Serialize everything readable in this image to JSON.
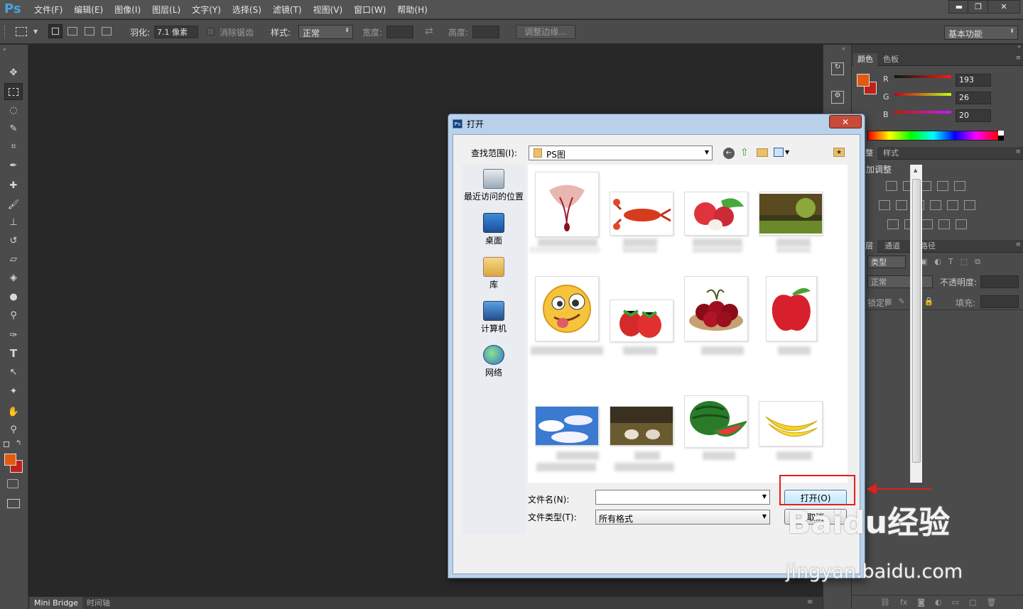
{
  "app": {
    "logo": "Ps"
  },
  "menu": [
    "文件(F)",
    "编辑(E)",
    "图像(I)",
    "图层(L)",
    "文字(Y)",
    "选择(S)",
    "滤镜(T)",
    "视图(V)",
    "窗口(W)",
    "帮助(H)"
  ],
  "window_controls": {
    "minimize": "▬",
    "restore": "❐",
    "close": "✕"
  },
  "options": {
    "feather_label": "羽化:",
    "feather_value": "7.1 像素",
    "antialias_label": "消除锯齿",
    "style_label": "样式:",
    "style_value": "正常",
    "width_label": "宽度:",
    "height_label": "高度:",
    "refine_edge": "调整边缘...",
    "workspace": "基本功能"
  },
  "bottom_tabs": [
    "Mini Bridge",
    "时间轴"
  ],
  "color_panel": {
    "tabs": [
      "颜色",
      "色板"
    ],
    "r_label": "R",
    "g_label": "G",
    "b_label": "B",
    "r": "193",
    "g": "26",
    "b": "20",
    "fg_color": "#e05a10",
    "bg_color": "#c1201a"
  },
  "adjust_panel": {
    "tabs": [
      "调整",
      "样式"
    ],
    "title": "添加调整"
  },
  "layers_panel": {
    "tabs": [
      "图层",
      "通道",
      "路径"
    ],
    "kind": "类型",
    "mode": "正常",
    "opacity_label": "不透明度:",
    "lock_label": "锁定:",
    "fill_label": "填充:"
  },
  "dialog": {
    "title": "打开",
    "look_in_label": "查找范围(I):",
    "folder": "PS图",
    "places": [
      "最近访问的位置",
      "桌面",
      "库",
      "计算机",
      "网络"
    ],
    "filename_label": "文件名(N):",
    "filename_value": "",
    "filetype_label": "文件类型(T):",
    "filetype_value": "所有格式",
    "open_button": "打开(O)",
    "cancel_button": "取消",
    "thumbnails": [
      "hands",
      "lobster",
      "lychee",
      "forest",
      "emoji",
      "strawberry",
      "cherry",
      "apple",
      "sky",
      "sheep",
      "watermelon",
      "banana"
    ]
  },
  "watermark": {
    "brand": "Baidu经验",
    "url": "jingyan.baidu.com"
  }
}
